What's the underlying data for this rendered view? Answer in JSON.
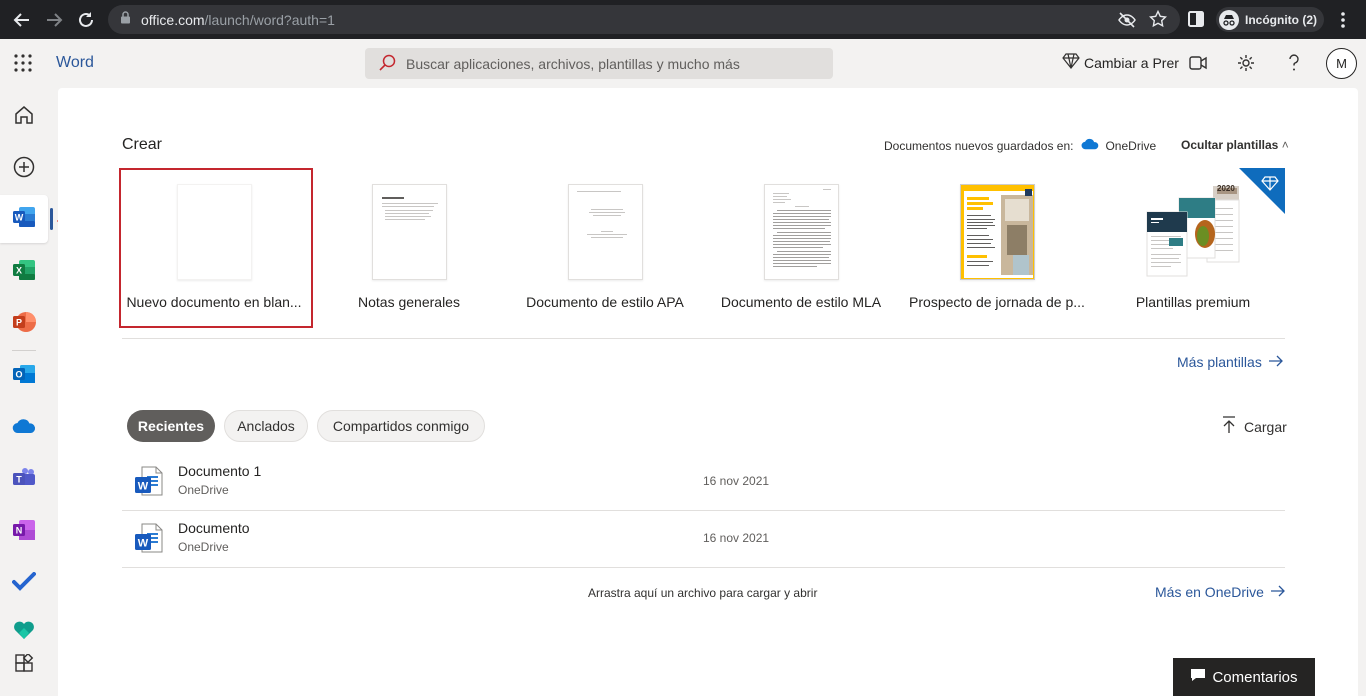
{
  "browser": {
    "url_host": "office.com",
    "url_path": "/launch/word?auth=1",
    "incognito_label": "Incógnito (2)"
  },
  "header": {
    "app_name": "Word",
    "search_placeholder": "Buscar aplicaciones, archivos, plantillas y mucho más",
    "premium_label": "Cambiar a Prer",
    "avatar_initial": "M"
  },
  "create": {
    "title": "Crear",
    "saved_in_label": "Documentos nuevos guardados en:",
    "saved_in_location": "OneDrive",
    "hide_templates_label": "Ocultar plantillas",
    "templates": [
      {
        "label": "Nuevo documento en blan..."
      },
      {
        "label": "Notas generales"
      },
      {
        "label": "Documento de estilo APA"
      },
      {
        "label": "Documento de estilo MLA"
      },
      {
        "label": "Prospecto de jornada de p..."
      },
      {
        "label": "Plantillas premium"
      }
    ],
    "more_templates_label": "Más plantillas",
    "flyer_title": "EVENTO NOMBRE AQUÍ",
    "premium_year": "2020"
  },
  "files": {
    "tabs": [
      {
        "label": "Recientes",
        "active": true
      },
      {
        "label": "Anclados",
        "active": false
      },
      {
        "label": "Compartidos conmigo",
        "active": false
      }
    ],
    "upload_label": "Cargar",
    "rows": [
      {
        "name": "Documento 1",
        "location": "OneDrive",
        "date": "16 nov 2021"
      },
      {
        "name": "Documento",
        "location": "OneDrive",
        "date": "16 nov 2021"
      }
    ],
    "drag_hint": "Arrastra aquí un archivo para cargar y abrir",
    "more_onedrive_label": "Más en OneDrive"
  },
  "feedback_label": "Comentarios",
  "colors": {
    "word_blue": "#2b579a",
    "highlight_red": "#c4262e",
    "premium_blue": "#0f6cbd"
  }
}
